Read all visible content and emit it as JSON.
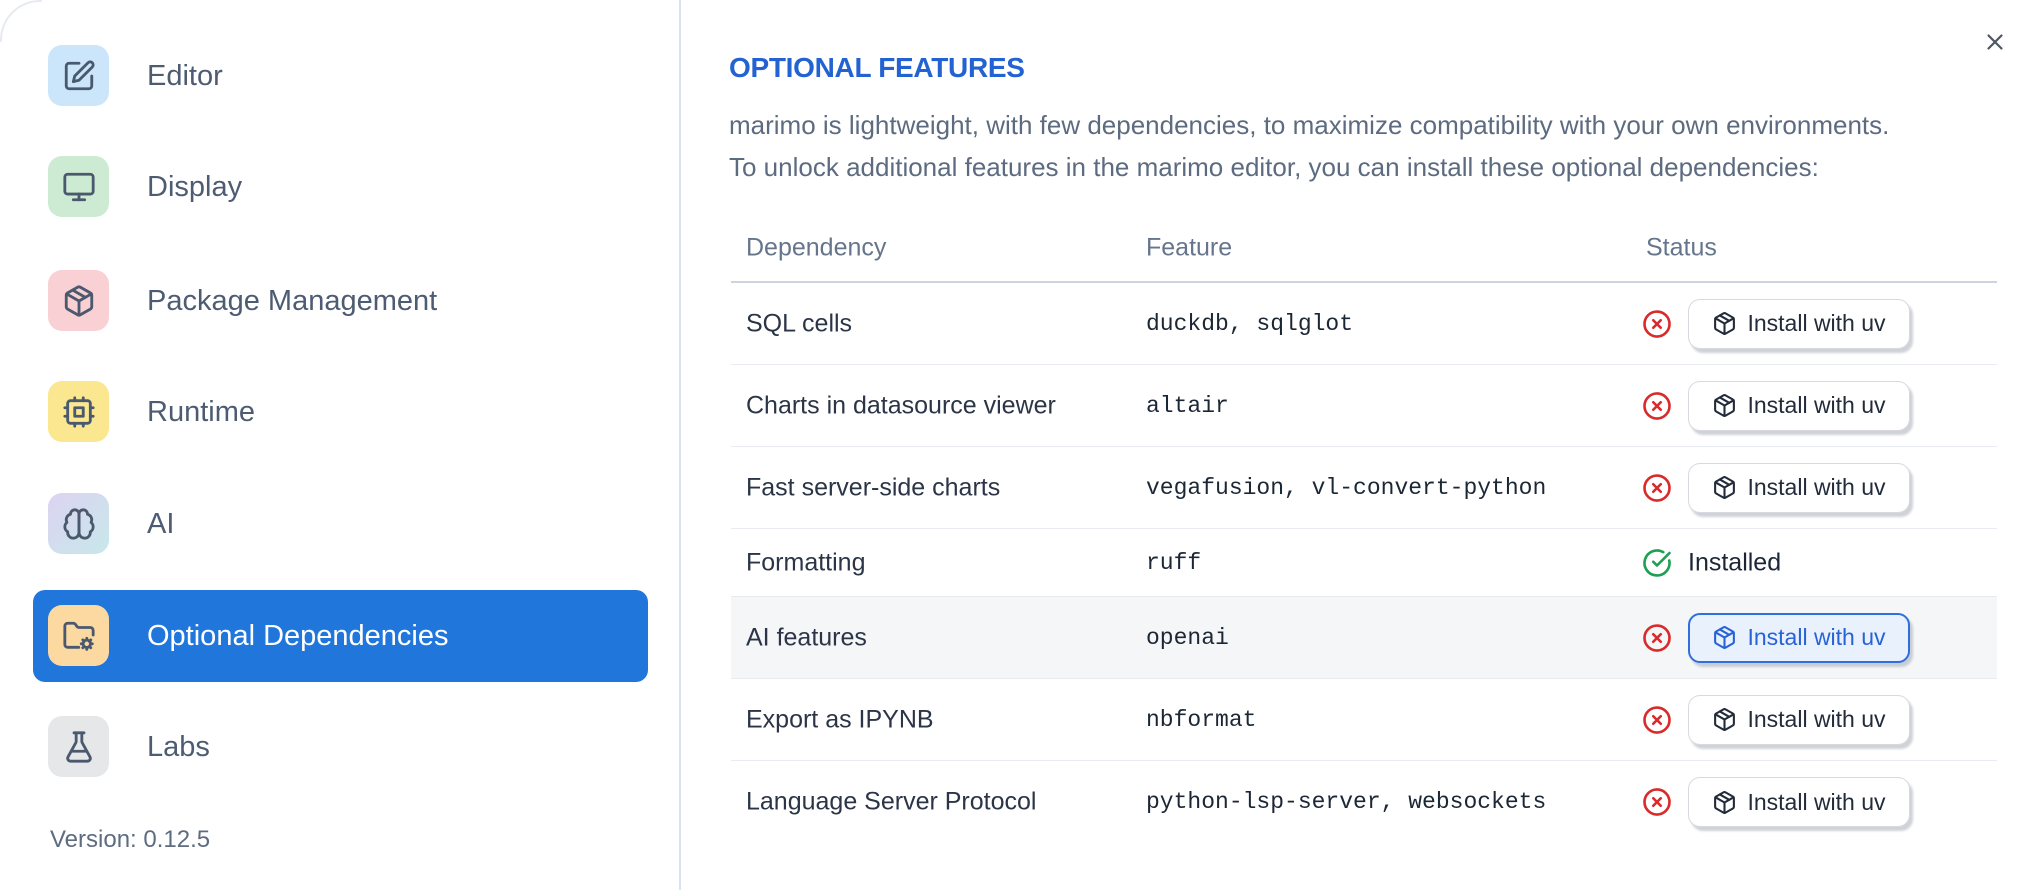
{
  "sidebar": {
    "items": [
      {
        "label": "Editor",
        "icon": "edit-square-icon",
        "icon_bg": "#cbe5fa",
        "selected": false
      },
      {
        "label": "Display",
        "icon": "monitor-icon",
        "icon_bg": "#cdead2",
        "selected": false
      },
      {
        "label": "Package Management",
        "icon": "package-icon",
        "icon_bg": "#f9d0d3",
        "selected": false
      },
      {
        "label": "Runtime",
        "icon": "cpu-icon",
        "icon_bg": "#fbe78f",
        "selected": false
      },
      {
        "label": "AI",
        "icon": "brain-icon",
        "icon_bg": "linear-gradient(135deg,#ddd3f2 0%,#c7e8ea 100%)",
        "selected": false
      },
      {
        "label": "Optional Dependencies",
        "icon": "folder-cog-icon",
        "icon_bg": "#fbd9a1",
        "selected": true
      },
      {
        "label": "Labs",
        "icon": "flask-icon",
        "icon_bg": "#e6e7e9",
        "selected": false
      }
    ],
    "version": "Version: 0.12.5"
  },
  "main": {
    "title": "OPTIONAL FEATURES",
    "description_line1": "marimo is lightweight, with few dependencies, to maximize compatibility with your own environments.",
    "description_line2": "To unlock additional features in the marimo editor, you can install these optional dependencies:",
    "table": {
      "columns": {
        "dependency": "Dependency",
        "feature": "Feature",
        "status": "Status"
      },
      "rows": [
        {
          "dependency": "SQL cells",
          "feature": "duckdb, sqlglot",
          "status": "not-installed",
          "action_label": "Install with uv"
        },
        {
          "dependency": "Charts in datasource viewer",
          "feature": "altair",
          "status": "not-installed",
          "action_label": "Install with uv"
        },
        {
          "dependency": "Fast server-side charts",
          "feature": "vegafusion, vl-convert-python",
          "status": "not-installed",
          "action_label": "Install with uv"
        },
        {
          "dependency": "Formatting",
          "feature": "ruff",
          "status": "installed",
          "status_label": "Installed"
        },
        {
          "dependency": "AI features",
          "feature": "openai",
          "status": "not-installed",
          "action_label": "Install with uv",
          "highlighted": true,
          "action_variant": "primary"
        },
        {
          "dependency": "Export as IPYNB",
          "feature": "nbformat",
          "status": "not-installed",
          "action_label": "Install with uv"
        },
        {
          "dependency": "Language Server Protocol",
          "feature": "python-lsp-server, websockets",
          "status": "not-installed",
          "action_label": "Install with uv"
        }
      ]
    }
  },
  "colors": {
    "accent_blue": "#2176dc",
    "title_blue": "#2262d3",
    "status_red": "#d92b2b",
    "status_green": "#1da053",
    "primary_button_border": "#2e6fdd",
    "primary_button_bg": "#e9f1fd",
    "row_highlight": "#f4f6f8"
  }
}
